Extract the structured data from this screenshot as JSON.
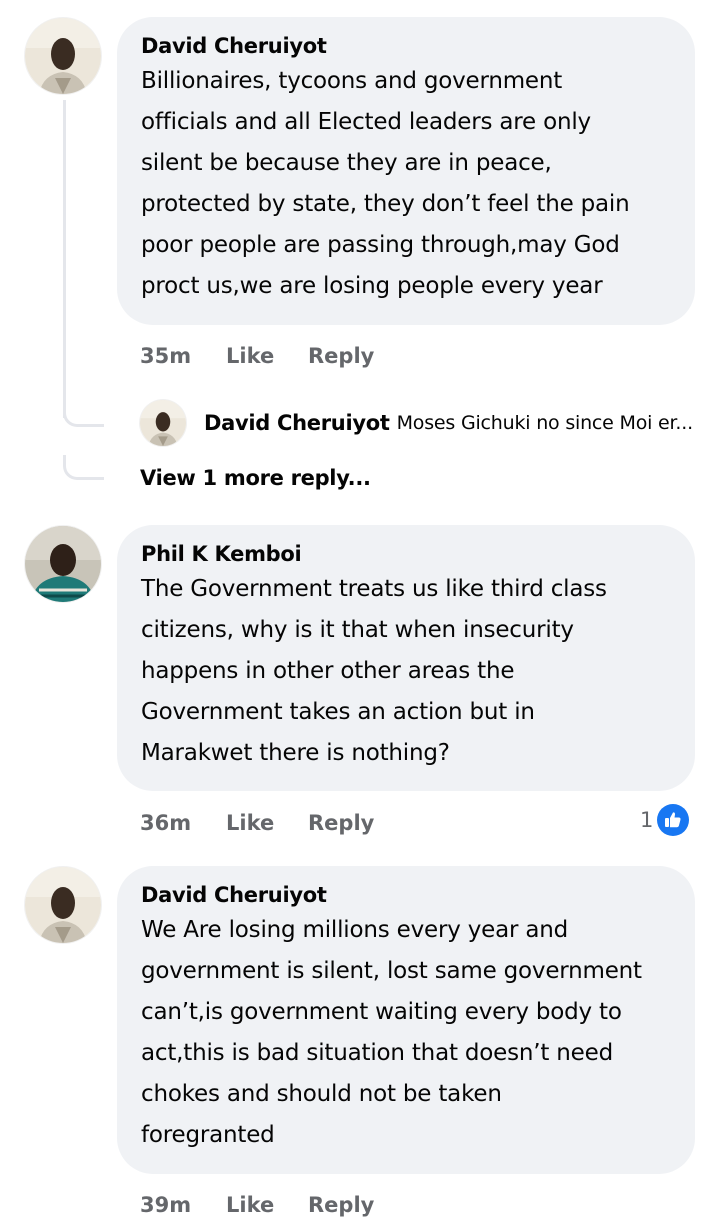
{
  "comments": [
    {
      "author": "David Cheruiyot",
      "text": "Billionaires, tycoons and government\nofficials and all Elected leaders are only\nsilent be because they are in peace,\nprotected by state, they don’t feel the pain\npoor people are passing through,may God\nproct us,we are losing people every year",
      "time": "35m",
      "like_label": "Like",
      "reply_label": "Reply",
      "replies": [
        {
          "author": "David Cheruiyot",
          "text": "Moses Gichuki no since Moi er..."
        }
      ],
      "view_more_label": "View 1 more reply..."
    },
    {
      "author": "Phil K Kemboi",
      "text": "The Government treats us like third class\ncitizens, why is it that when insecurity\nhappens in other other areas the\nGovernment takes an action but in\nMarakwet there is nothing?",
      "time": "36m",
      "like_label": "Like",
      "reply_label": "Reply",
      "reaction_count": "1"
    },
    {
      "author": "David Cheruiyot",
      "text": "We Are losing millions every year and\ngovernment is silent, lost same government\ncan’t,is government waiting every body to\nact,this is bad situation that doesn’t need\nchokes and should not be taken\nforegranted",
      "time": "39m",
      "like_label": "Like",
      "reply_label": "Reply"
    }
  ],
  "colors": {
    "bubble": "#f0f2f5",
    "meta_text": "#65676b",
    "like_blue": "#1877f2"
  },
  "icons": {
    "reaction": "like-thumbs-up-icon"
  }
}
